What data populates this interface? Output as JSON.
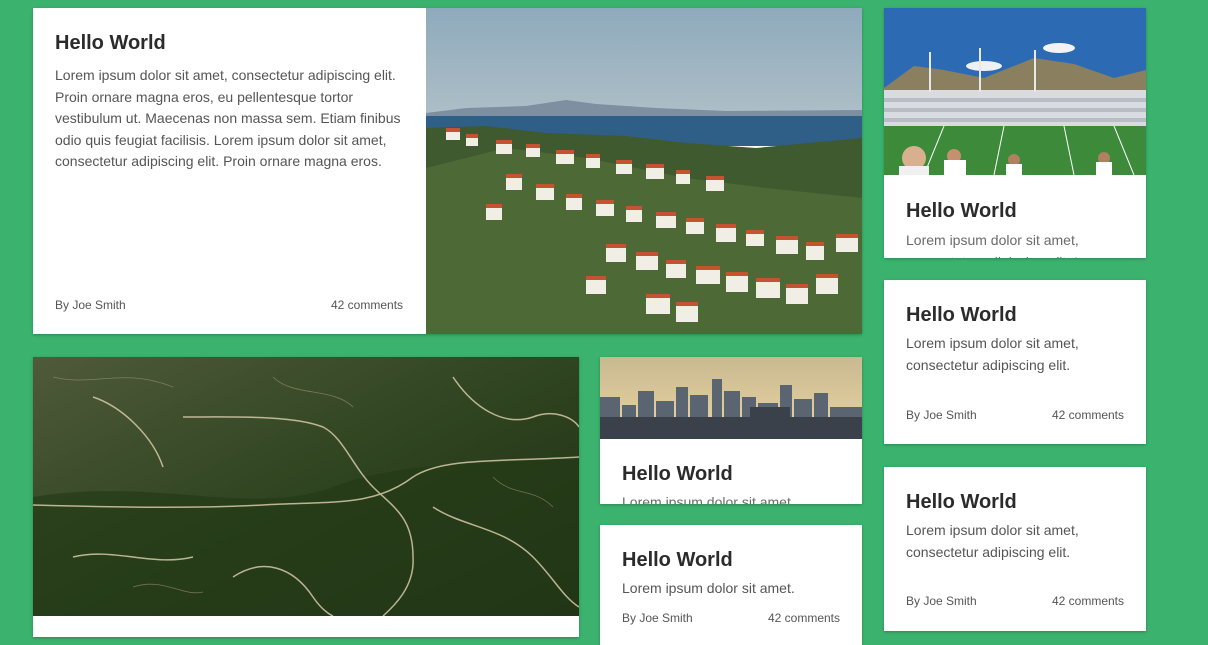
{
  "cards": [
    {
      "title": "Hello World",
      "body": "Lorem ipsum dolor sit amet, consectetur adipiscing elit. Proin ornare magna eros, eu pellentesque tortor vestibulum ut. Maecenas non massa sem. Etiam finibus odio quis feugiat facilisis. Lorem ipsum dolor sit amet, consectetur adipiscing elit. Proin ornare magna eros.",
      "author": "By Joe Smith",
      "comments": "42 comments",
      "image": "coastal-town-photo"
    },
    {
      "title": "Hello World",
      "body": "Lorem ipsum dolor sit amet, consectetur adipiscing elit. Lorem ipsum dolor sit amet, consectetur",
      "image": "stadium-photo"
    },
    {
      "image": "aerial-landscape-photo"
    },
    {
      "title": "Hello World",
      "body": "Lorem ipsum dolor sit amet, consectetur adipiscing elit.",
      "image": "city-skyline-photo"
    },
    {
      "title": "Hello World",
      "body": "Lorem ipsum dolor sit amet.",
      "author": "By Joe Smith",
      "comments": "42 comments"
    },
    {
      "title": "Hello World",
      "body": "Lorem ipsum dolor sit amet, consectetur adipiscing elit.",
      "author": "By Joe Smith",
      "comments": "42 comments"
    },
    {
      "title": "Hello World",
      "body": "Lorem ipsum dolor sit amet, consectetur adipiscing elit.",
      "author": "By Joe Smith",
      "comments": "42 comments"
    }
  ],
  "colors": {
    "background": "#3bb36e",
    "card": "#ffffff",
    "title": "#2b2b2b",
    "text": "#555555"
  }
}
